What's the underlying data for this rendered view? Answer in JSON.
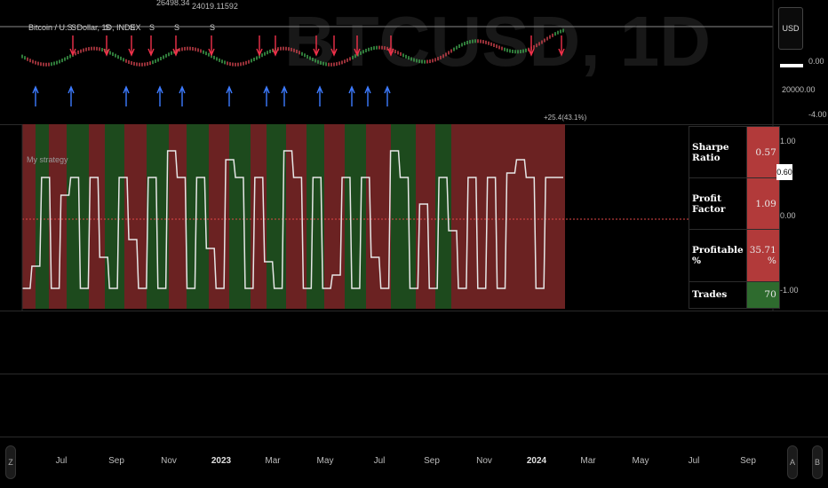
{
  "header": {
    "symbol_title": "Bitcoin / U.S. Dollar, 1D, INDEX",
    "watermark": "BTCUSD, 1D",
    "top_annotation_1": "26498.34",
    "top_annotation_2": "24019.11592",
    "bottom_annotation": "+25.4(43.1%)"
  },
  "price_scale": {
    "currency_button": "USD",
    "level_zero": "0.00",
    "level_20000": "20000.00",
    "level_minus4": "-4.00"
  },
  "strategy_pane": {
    "title": "My strategy",
    "scale": {
      "top": "1.00",
      "current": "0.60",
      "mid": "0.00",
      "bottom": "-1.00"
    }
  },
  "stats": {
    "rows": [
      {
        "label": "Sharpe Ratio",
        "value": "0.57",
        "color": "#b23a3a"
      },
      {
        "label": "Profit Factor",
        "value": "1.09",
        "color": "#b23a3a"
      },
      {
        "label": "Profitable %",
        "value": "35.71 %",
        "color": "#b23a3a"
      },
      {
        "label": "Trades",
        "value": "70",
        "color": "#2e6b2e"
      }
    ]
  },
  "time_axis": {
    "labels": [
      "Jul",
      "Sep",
      "Nov",
      "2023",
      "Mar",
      "May",
      "Jul",
      "Sep",
      "Nov",
      "2024",
      "Mar",
      "May",
      "Jul",
      "Sep"
    ],
    "bold": [
      "2023",
      "2024"
    ],
    "left_button": "Z",
    "right_button_1": "A",
    "right_button_2": "B"
  },
  "signals": {
    "sell_label": "S",
    "sell_count_labels": 7
  },
  "colors": {
    "sell_arrow": "#f0314a",
    "buy_arrow": "#3d7bff",
    "band_red": "#6b2222",
    "band_green": "#1d4a1d",
    "strategy_line": "#e6e6e6",
    "zero_line": "#e04848"
  }
}
